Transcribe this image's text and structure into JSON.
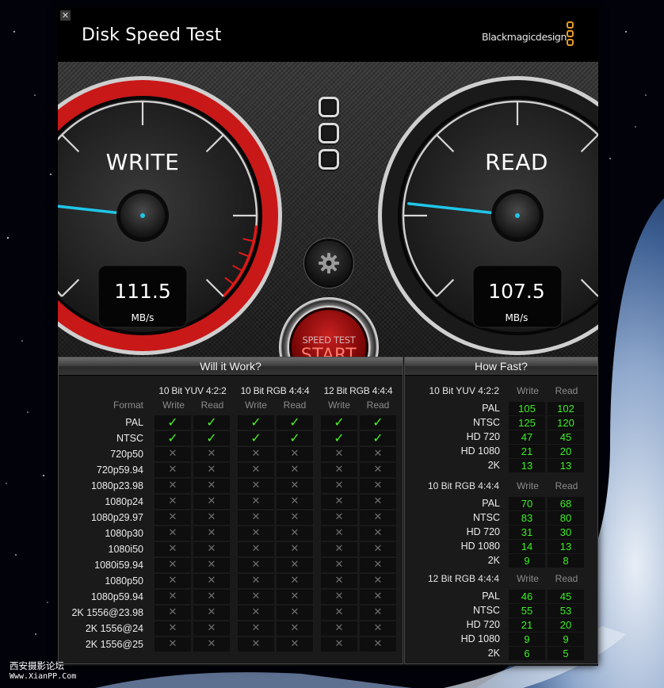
{
  "app": {
    "title": "Disk Speed Test",
    "brand": "Blackmagicdesign",
    "close_glyph": "✕",
    "accent_color": "#c81818",
    "needle_color": "#1fc6e8"
  },
  "gauges": {
    "write": {
      "label": "WRITE",
      "value": "111.5",
      "unit": "MB/s",
      "needle_fraction": 0.19
    },
    "read": {
      "label": "READ",
      "value": "107.5",
      "unit": "MB/s",
      "needle_fraction": 0.19
    }
  },
  "controls": {
    "settings_icon": "gear-icon",
    "start_small": "SPEED TEST",
    "start_big": "START"
  },
  "will_it_work": {
    "title": "Will it Work?",
    "format_header": "Format",
    "groups": [
      {
        "name": "10 Bit YUV 4:2:2",
        "write": "Write",
        "read": "Read"
      },
      {
        "name": "10 Bit RGB 4:4:4",
        "write": "Write",
        "read": "Read"
      },
      {
        "name": "12 Bit RGB 4:4:4",
        "write": "Write",
        "read": "Read"
      }
    ],
    "check_glyph": "✓",
    "cross_glyph": "✕",
    "rows": [
      {
        "format": "PAL",
        "cells": [
          true,
          true,
          true,
          true,
          true,
          true
        ]
      },
      {
        "format": "NTSC",
        "cells": [
          true,
          true,
          true,
          true,
          true,
          true
        ]
      },
      {
        "format": "720p50",
        "cells": [
          false,
          false,
          false,
          false,
          false,
          false
        ]
      },
      {
        "format": "720p59.94",
        "cells": [
          false,
          false,
          false,
          false,
          false,
          false
        ]
      },
      {
        "format": "1080p23.98",
        "cells": [
          false,
          false,
          false,
          false,
          false,
          false
        ]
      },
      {
        "format": "1080p24",
        "cells": [
          false,
          false,
          false,
          false,
          false,
          false
        ]
      },
      {
        "format": "1080p29.97",
        "cells": [
          false,
          false,
          false,
          false,
          false,
          false
        ]
      },
      {
        "format": "1080p30",
        "cells": [
          false,
          false,
          false,
          false,
          false,
          false
        ]
      },
      {
        "format": "1080i50",
        "cells": [
          false,
          false,
          false,
          false,
          false,
          false
        ]
      },
      {
        "format": "1080i59.94",
        "cells": [
          false,
          false,
          false,
          false,
          false,
          false
        ]
      },
      {
        "format": "1080p50",
        "cells": [
          false,
          false,
          false,
          false,
          false,
          false
        ]
      },
      {
        "format": "1080p59.94",
        "cells": [
          false,
          false,
          false,
          false,
          false,
          false
        ]
      },
      {
        "format": "2K 1556@23.98",
        "cells": [
          false,
          false,
          false,
          false,
          false,
          false
        ]
      },
      {
        "format": "2K 1556@24",
        "cells": [
          false,
          false,
          false,
          false,
          false,
          false
        ]
      },
      {
        "format": "2K 1556@25",
        "cells": [
          false,
          false,
          false,
          false,
          false,
          false
        ]
      }
    ]
  },
  "how_fast": {
    "title": "How Fast?",
    "groups": [
      {
        "name": "10 Bit YUV 4:2:2",
        "write": "Write",
        "read": "Read",
        "rows": [
          {
            "format": "PAL",
            "write": "105",
            "read": "102"
          },
          {
            "format": "NTSC",
            "write": "125",
            "read": "120"
          },
          {
            "format": "HD 720",
            "write": "47",
            "read": "45"
          },
          {
            "format": "HD 1080",
            "write": "21",
            "read": "20"
          },
          {
            "format": "2K",
            "write": "13",
            "read": "13"
          }
        ]
      },
      {
        "name": "10 Bit RGB 4:4:4",
        "write": "Write",
        "read": "Read",
        "rows": [
          {
            "format": "PAL",
            "write": "70",
            "read": "68"
          },
          {
            "format": "NTSC",
            "write": "83",
            "read": "80"
          },
          {
            "format": "HD 720",
            "write": "31",
            "read": "30"
          },
          {
            "format": "HD 1080",
            "write": "14",
            "read": "13"
          },
          {
            "format": "2K",
            "write": "9",
            "read": "8"
          }
        ]
      },
      {
        "name": "12 Bit RGB 4:4:4",
        "write": "Write",
        "read": "Read",
        "rows": [
          {
            "format": "PAL",
            "write": "46",
            "read": "45"
          },
          {
            "format": "NTSC",
            "write": "55",
            "read": "53"
          },
          {
            "format": "HD 720",
            "write": "21",
            "read": "20"
          },
          {
            "format": "HD 1080",
            "write": "9",
            "read": "9"
          },
          {
            "format": "2K",
            "write": "6",
            "read": "5"
          }
        ]
      }
    ]
  },
  "watermark": {
    "line1": "西安摄影论坛",
    "line2": "Www.XianPP.Com"
  }
}
